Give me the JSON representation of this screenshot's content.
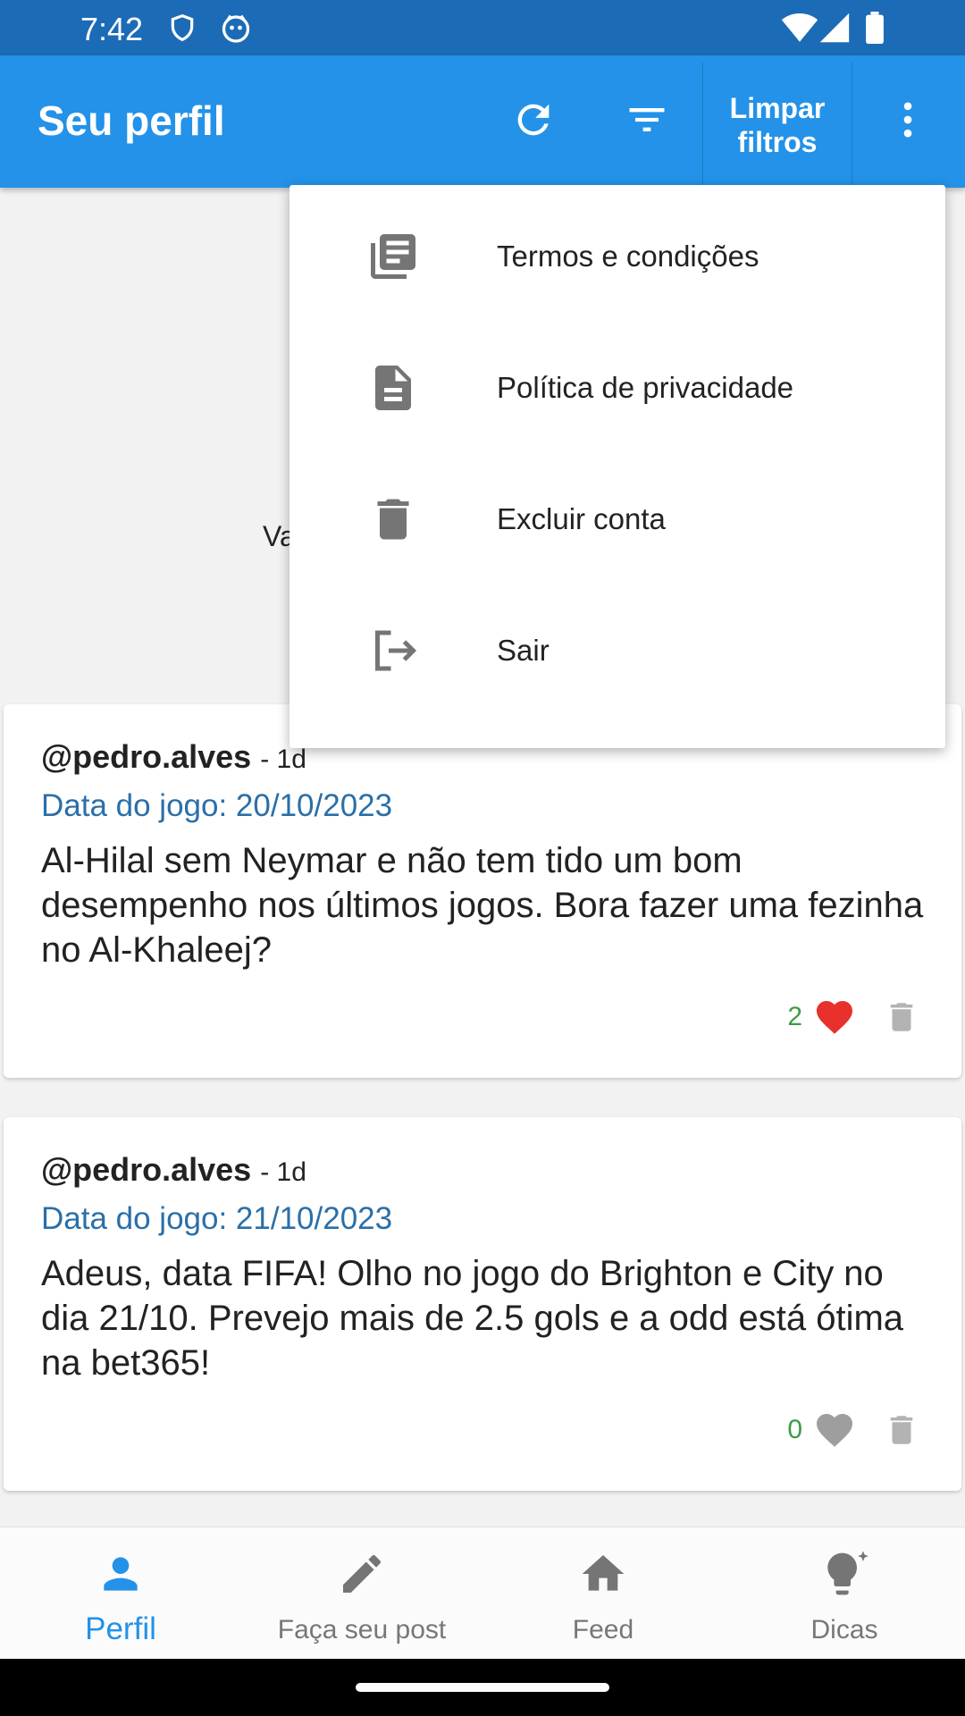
{
  "status_bar": {
    "time": "7:42"
  },
  "app_bar": {
    "title": "Seu perfil",
    "clear_filters_label": "Limpar filtros"
  },
  "background": {
    "partial_text": "Va"
  },
  "menu": {
    "items": [
      {
        "label": "Termos e condições",
        "icon": "terms-icon"
      },
      {
        "label": "Política de privacidade",
        "icon": "document-icon"
      },
      {
        "label": "Excluir conta",
        "icon": "trash-icon"
      },
      {
        "label": "Sair",
        "icon": "logout-icon"
      }
    ]
  },
  "posts": [
    {
      "user": "@pedro.alves",
      "ago": "- 1d",
      "game_date": "Data do jogo: 20/10/2023",
      "text": "Al-Hilal sem Neymar e não tem tido um bom desempenho nos últimos jogos. Bora fazer uma fezinha no Al-Khaleej?",
      "likes": "2",
      "liked": true
    },
    {
      "user": "@pedro.alves",
      "ago": "- 1d",
      "game_date": "Data do jogo: 21/10/2023",
      "text": "Adeus, data FIFA! Olho no jogo do Brighton e City no dia 21/10. Prevejo mais de 2.5 gols e a odd está ótima na bet365!",
      "likes": "0",
      "liked": false
    }
  ],
  "bottom_nav": {
    "items": [
      {
        "label": "Perfil",
        "icon": "person-icon",
        "active": true
      },
      {
        "label": "Faça seu post",
        "icon": "pencil-icon",
        "active": false
      },
      {
        "label": "Feed",
        "icon": "home-icon",
        "active": false
      },
      {
        "label": "Dicas",
        "icon": "lightbulb-icon",
        "active": false
      }
    ]
  },
  "colors": {
    "status_bar": "#1c6bb6",
    "app_bar": "#2392e8",
    "accent": "#2392e8",
    "heart_active": "#e8302c",
    "like_count": "#3d9b45",
    "game_date": "#2a6fa8"
  }
}
